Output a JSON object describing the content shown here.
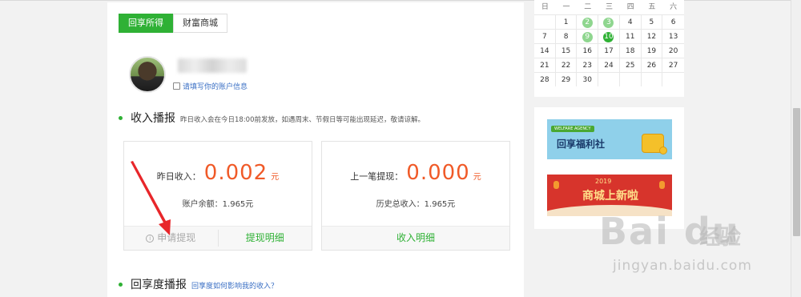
{
  "tabs": [
    {
      "label": "回享所得",
      "active": true
    },
    {
      "label": "财富商城",
      "active": false
    }
  ],
  "profile": {
    "account_link": "请填写你的账户信息"
  },
  "income_section": {
    "title": "收入播报",
    "note": "昨日收入会在今日18:00前发放，如遇周末、节假日等可能出现延迟，敬请谅解。"
  },
  "card_left": {
    "label": "昨日收入：",
    "value": "0.002",
    "unit": "元",
    "sub": "账户余额：1.965元",
    "btn_withdraw": "申请提现",
    "btn_detail": "提现明细"
  },
  "card_right": {
    "label": "上一笔提现：",
    "value": "0.000",
    "unit": "元",
    "sub": "历史总收入：1.965元",
    "btn_detail": "收入明细"
  },
  "share_section": {
    "title": "回享度播报",
    "link": "回享度如何影响我的收入？"
  },
  "calendar": {
    "weekdays": [
      "日",
      "一",
      "二",
      "三",
      "四",
      "五",
      "六"
    ],
    "weeks": [
      [
        "",
        "1",
        "2",
        "3",
        "4",
        "5",
        "6"
      ],
      [
        "7",
        "8",
        "9",
        "10",
        "11",
        "12",
        "13"
      ],
      [
        "14",
        "15",
        "16",
        "17",
        "18",
        "19",
        "20"
      ],
      [
        "21",
        "22",
        "23",
        "24",
        "25",
        "26",
        "27"
      ],
      [
        "28",
        "29",
        "30",
        "",
        "",
        "",
        ""
      ]
    ],
    "marked": [
      "2",
      "3",
      "9"
    ],
    "today": "10",
    "mark_color": "#8fd68f",
    "today_color": "#2fb135"
  },
  "banners": {
    "b1_ribbon": "WELFARE AGENCY",
    "b1_text": "回享福利社",
    "b2_year": "2019",
    "b2_text": "商城上新啦"
  },
  "watermark": {
    "logo": "Bai du",
    "cn": "经验",
    "url": "jingyan.baidu.com"
  },
  "colors": {
    "accent": "#2fb135",
    "value": "#f05a28",
    "link": "#3a6fc4"
  }
}
